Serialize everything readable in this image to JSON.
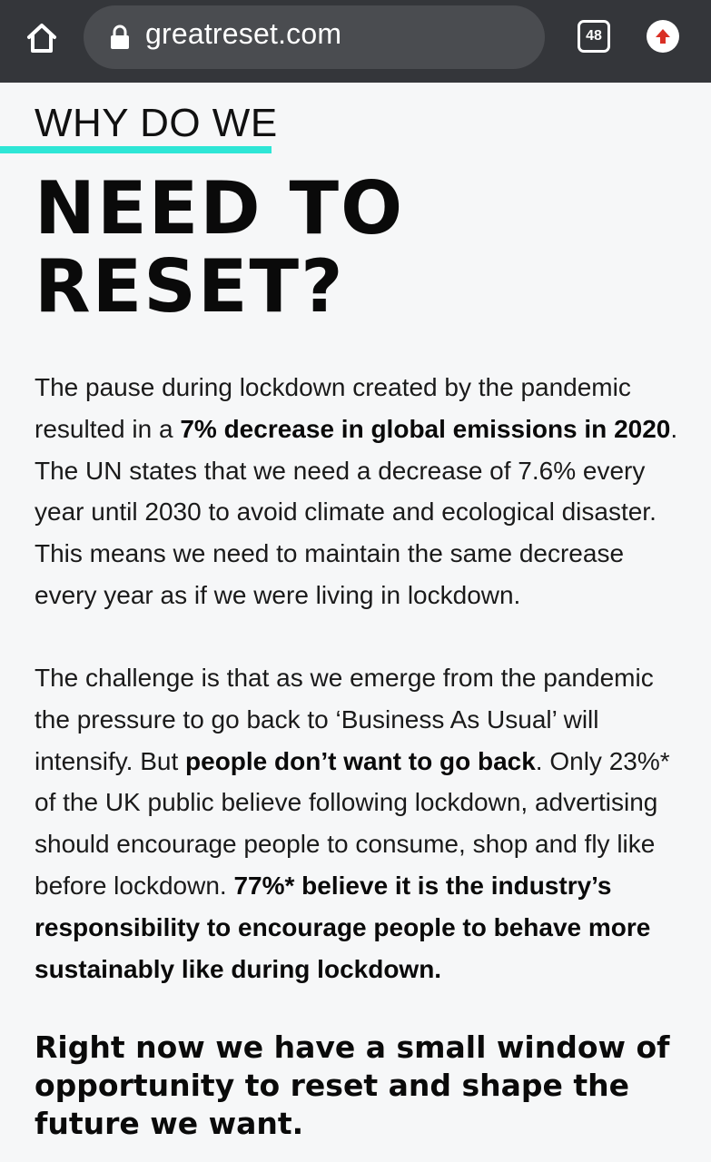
{
  "browser": {
    "url": "greatreset.com",
    "tab_count": "48",
    "icons": {
      "home": "home-icon",
      "lock": "lock-icon",
      "tabs": "tabs-icon",
      "update": "update-arrow-icon"
    }
  },
  "colors": {
    "accent": "#2ee6d6",
    "browser_bar": "#34363a",
    "url_pill": "#4a4c50",
    "update_arrow": "#d93025"
  },
  "article": {
    "kicker": "WHY DO WE",
    "headline": "NEED TO\nRESET?",
    "paragraph1": {
      "s1": "The pause during lockdown created by the pandemic resulted in a ",
      "b1": "7% decrease in global emissions in 2020",
      "s2": ". The UN states that we need a decrease of 7.6% every year until 2030 to avoid climate and ecological disaster. This means we need to maintain the same decrease every year as if we were living in lockdown."
    },
    "paragraph2": {
      "s1": "The challenge is that as we emerge from the pandemic the pressure to go back to ‘Business As Usual’ will intensify. But ",
      "b1": "people don’t want to go back",
      "s2": ". Only 23%* of the UK public believe following lockdown, advertising should encourage people to consume, shop and fly like before lockdown. ",
      "b2": "77%* believe it is the industry’s responsibility to encourage people to behave more sustainably like during lockdown."
    },
    "closing": "Right now we have a small window of opportunity to reset and shape the future we want."
  }
}
